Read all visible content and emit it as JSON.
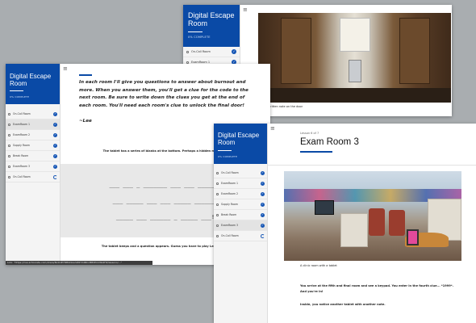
{
  "app": {
    "title": "Digital Escape Room",
    "subtitle": "0% COMPLETE"
  },
  "menu": [
    {
      "label": "On-Call Room",
      "status": "complete"
    },
    {
      "label": "ExamRoom 1",
      "status": "complete"
    },
    {
      "label": "ExamRoom 2",
      "status": "complete"
    },
    {
      "label": "Supply Room",
      "status": "complete"
    },
    {
      "label": "Break Room",
      "status": "complete"
    },
    {
      "label": "ExamRoom 3",
      "status": "complete"
    },
    {
      "label": "On-Call Room",
      "status": "in-progress"
    }
  ],
  "window_back": {
    "caption": "A handwritten note on the door"
  },
  "window_left": {
    "intro": "In each room I'll give you questions to answer about burnout and more. When you answer them, you'll get a clue for the code to the next room. Be sure to write down the clues you get at the end of each room. You'll need each room's clue to unlock the final door!",
    "signature": "~Lee",
    "tablet_text": "The tablet has a series of blanks at the bottom. Perhaps a hidden message?",
    "blank_lines": [
      "___ ___ _ _______ ___ ___ _______",
      "___ _____ ___ ___ _____ ______.",
      "_____ ___ ______ _ _____ ___!"
    ],
    "bottom_text": "The tablet beeps and a question appears. Guess you have to play Lee's game.",
    "status_url": "Link: \"https://rise.articulate.com/share/NxO1EY8M4r0AoVZ6YVdBCcMB3PmV8z2F#/lessons/...\""
  },
  "window_front": {
    "lesson_label": "Lesson 6 of 7",
    "lesson_title": "Exam Room 3",
    "photo_caption": "A clinic room with a tablet",
    "paragraph1": "You arrive at the fifth and final room and see a keypad. You enter in the fourth clue... *1999*. And you're in!",
    "paragraph2": "Inside, you notice another tablet with another note."
  },
  "colors": {
    "brand": "#0a4aa6",
    "check": "#1656b5",
    "desktop": "#a9adb0"
  },
  "icons": [
    "menu-icon",
    "lock-icon",
    "check-icon",
    "spinner-icon"
  ]
}
